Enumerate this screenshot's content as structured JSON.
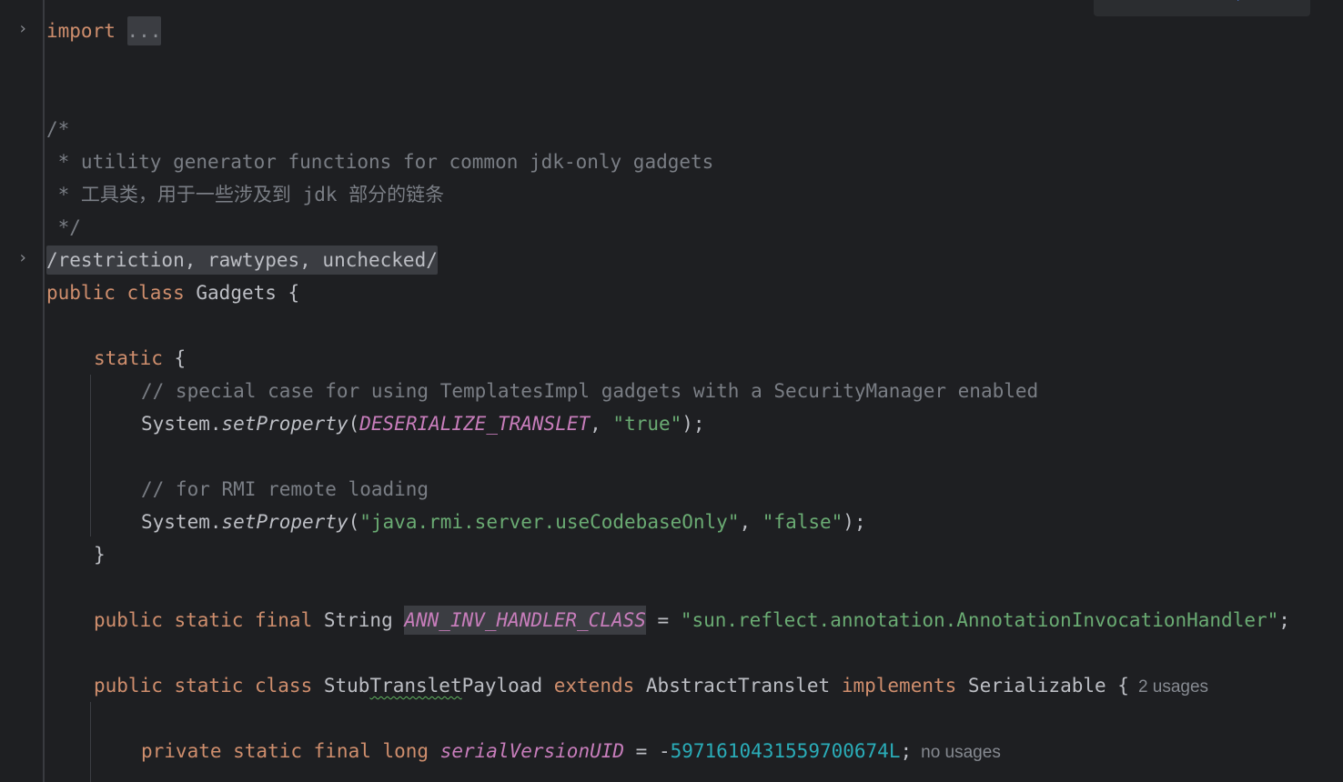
{
  "editor": {
    "colors": {
      "background": "#1e1f22",
      "keyword": "#cf8e6d",
      "comment": "#7a7e85",
      "string": "#6aab73",
      "number": "#2aacb8",
      "constant": "#c77dbb",
      "text": "#bcbec4"
    },
    "line1": {
      "kw": "import",
      "fold_chip": "..."
    },
    "comment": {
      "l1": "/*",
      "l2": " * utility generator functions for common jdk-only gadgets",
      "l3": " * 工具类，用于一些涉及到 jdk 部分的链条",
      "l4": " */"
    },
    "annotation_fold": "/restriction, rawtypes, unchecked/",
    "class_decl": {
      "kw1": "public",
      "kw2": "class",
      "name": "Gadgets {"
    },
    "static_block": {
      "kw": "static",
      "brace": " {",
      "c1": "// special case for using TemplatesImpl gadgets with a SecurityManager enabled",
      "call1_obj": "System.",
      "call1_meth": "setProperty",
      "call1_open": "(",
      "call1_const": "DESERIALIZE_TRANSLET",
      "call1_sep": ", ",
      "call1_str": "\"true\"",
      "call1_close": ");",
      "c2": "// for RMI remote loading",
      "call2_obj": "System.",
      "call2_meth": "setProperty",
      "call2_open": "(",
      "call2_str1": "\"java.rmi.server.useCodebaseOnly\"",
      "call2_sep": ", ",
      "call2_str2": "\"false\"",
      "call2_close": ");",
      "close": "}"
    },
    "field": {
      "kw": "public static final",
      "type": " String ",
      "name": "ANN_INV_HANDLER_CLASS",
      "eq": " = ",
      "value": "\"sun.reflect.annotation.AnnotationInvocationHandler\"",
      "semi": ";"
    },
    "inner_class": {
      "kw": "public static class",
      "name_pre": " Stub",
      "name_sq": "Translet",
      "name_post": "Payload ",
      "extends": "extends",
      "parent": " AbstractTranslet ",
      "implements": "implements",
      "iface": " Serializable {",
      "usages": "2 usages"
    },
    "serial": {
      "kw": "private static final long",
      "name": "serialVersionUID",
      "eq": " = -",
      "value": "5971610431559700674L",
      "semi": ";",
      "usages": "no usages"
    }
  }
}
